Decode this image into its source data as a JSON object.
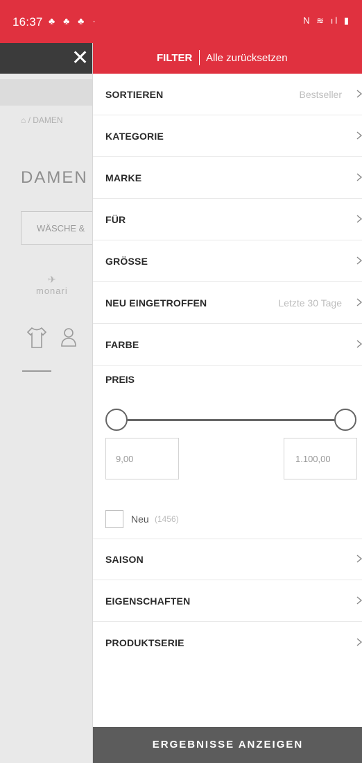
{
  "status_bar": {
    "time": "16:37",
    "notifications": "♣ ♣ ♣ ·",
    "system_icons": "N ≋ ıl ▮"
  },
  "background_page": {
    "breadcrumb": "⌂ / DAMEN",
    "title": "DAMEN",
    "select_value": "WÄSCHE &",
    "brand": "monari",
    "close_icon": "close-icon"
  },
  "filter": {
    "title": "FILTER",
    "reset_label": "Alle zurücksetzen",
    "rows_top": [
      {
        "label": "SORTIEREN",
        "value": "Bestseller"
      },
      {
        "label": "KATEGORIE",
        "value": ""
      },
      {
        "label": "MARKE",
        "value": ""
      },
      {
        "label": "FÜR",
        "value": ""
      },
      {
        "label": "GRÖSSE",
        "value": ""
      },
      {
        "label": "NEU EINGETROFFEN",
        "value": "Letzte 30 Tage"
      },
      {
        "label": "FARBE",
        "value": ""
      }
    ],
    "price": {
      "label": "PREIS",
      "min": "9,00",
      "max": "1.100,00",
      "range_min_fraction": 0,
      "range_max_fraction": 1
    },
    "new_checkbox": {
      "label": "Neu",
      "count": "(1456)",
      "checked": false
    },
    "rows_bottom": [
      {
        "label": "SAISON"
      },
      {
        "label": "EIGENSCHAFTEN"
      },
      {
        "label": "PRODUKTSERIE"
      }
    ],
    "results_button": "ERGEBNISSE ANZEIGEN"
  },
  "colors": {
    "accent": "#e0313f",
    "header_dark": "#3b3b3b",
    "button_gray": "#5c5c5c"
  }
}
